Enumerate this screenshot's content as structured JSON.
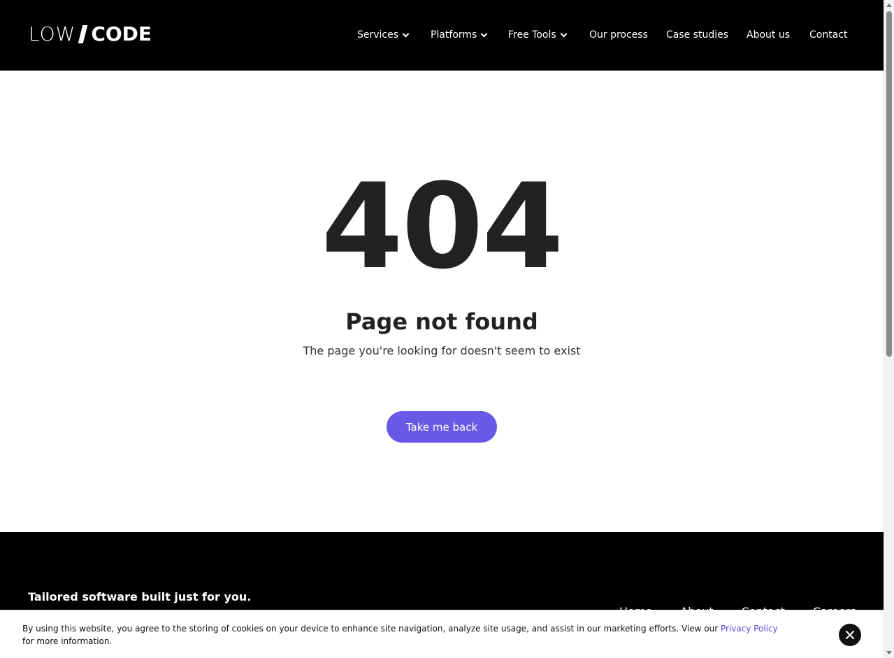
{
  "header": {
    "logo": {
      "light": "LOW",
      "bold": "CODE"
    },
    "nav": [
      {
        "label": "Services",
        "dropdown": true
      },
      {
        "label": "Platforms",
        "dropdown": true
      },
      {
        "label": "Free Tools",
        "dropdown": true
      },
      {
        "label": "Our process",
        "dropdown": false
      },
      {
        "label": "Case studies",
        "dropdown": false
      },
      {
        "label": "About us",
        "dropdown": false
      },
      {
        "label": "Contact",
        "dropdown": false
      }
    ]
  },
  "main": {
    "code": "404",
    "title": "Page not found",
    "subtitle": "The page you're looking for doesn't seem to exist",
    "button": "Take me back"
  },
  "footer": {
    "tagline": "Tailored software built just for you.",
    "links": [
      "Home",
      "About",
      "Contact",
      "Careers"
    ]
  },
  "cookie": {
    "text_before": "By using this website, you agree to the storing of cookies on your device to enhance site navigation, analyze site usage, and assist in our marketing efforts. View our ",
    "link": "Privacy Policy",
    "text_after": " for more information."
  },
  "colors": {
    "accent": "#6a58e6",
    "header_bg": "#000000",
    "text_dark": "#222222"
  }
}
